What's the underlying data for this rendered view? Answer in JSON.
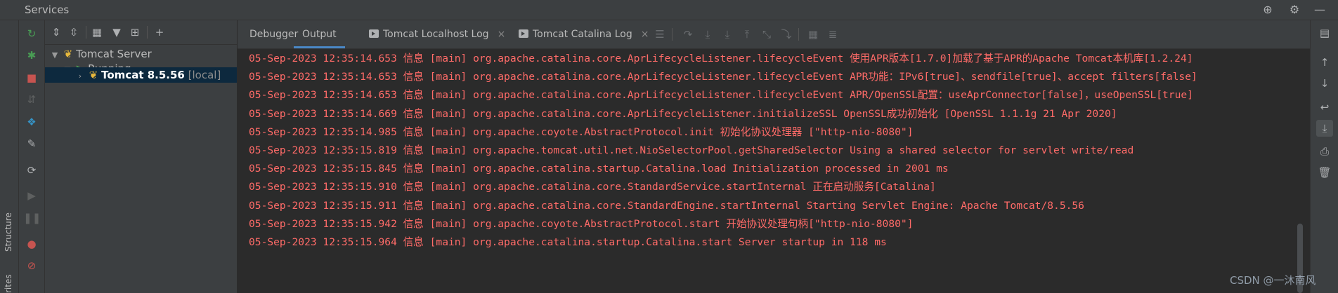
{
  "window": {
    "title": "Services",
    "icons": [
      "crosshair-icon",
      "gear-icon",
      "minimize-icon"
    ]
  },
  "left_strip": {
    "tabs": [
      {
        "label": "Structure"
      },
      {
        "label": "rites"
      }
    ]
  },
  "tree": {
    "nodes": [
      {
        "label": "Tomcat Server",
        "suffix": ""
      },
      {
        "label": "Running",
        "suffix": ""
      },
      {
        "label": "Tomcat 8.5.56",
        "suffix": "[local]"
      }
    ]
  },
  "console": {
    "tabs": [
      {
        "label": "Debugger"
      },
      {
        "label": "Output"
      },
      {
        "label": "Tomcat Localhost Log"
      },
      {
        "label": "Tomcat Catalina Log"
      }
    ],
    "close_glyph": "×",
    "lines": [
      "05-Sep-2023 12:35:14.653 信息 [main] org.apache.catalina.core.AprLifecycleListener.lifecycleEvent 使用APR版本[1.7.0]加载了基于APR的Apache Tomcat本机库[1.2.24]",
      "05-Sep-2023 12:35:14.653 信息 [main] org.apache.catalina.core.AprLifecycleListener.lifecycleEvent APR功能：IPv6[true]、sendfile[true]、accept filters[false]",
      "05-Sep-2023 12:35:14.653 信息 [main] org.apache.catalina.core.AprLifecycleListener.lifecycleEvent APR/OpenSSL配置：useAprConnector[false]，useOpenSSL[true]",
      "05-Sep-2023 12:35:14.669 信息 [main] org.apache.catalina.core.AprLifecycleListener.initializeSSL OpenSSL成功初始化 [OpenSSL 1.1.1g  21 Apr 2020]",
      "05-Sep-2023 12:35:14.985 信息 [main] org.apache.coyote.AbstractProtocol.init 初始化协议处理器 [\"http-nio-8080\"]",
      "05-Sep-2023 12:35:15.819 信息 [main] org.apache.tomcat.util.net.NioSelectorPool.getSharedSelector Using a shared selector for servlet write/read",
      "05-Sep-2023 12:35:15.845 信息 [main] org.apache.catalina.startup.Catalina.load Initialization processed in 2001 ms",
      "05-Sep-2023 12:35:15.910 信息 [main] org.apache.catalina.core.StandardService.startInternal 正在启动服务[Catalina]",
      "05-Sep-2023 12:35:15.911 信息 [main] org.apache.catalina.core.StandardEngine.startInternal Starting Servlet Engine: Apache Tomcat/8.5.56",
      "05-Sep-2023 12:35:15.942 信息 [main] org.apache.coyote.AbstractProtocol.start 开始协议处理句柄[\"http-nio-8080\"]",
      "05-Sep-2023 12:35:15.964 信息 [main] org.apache.catalina.startup.Catalina.start Server startup in 118 ms"
    ]
  },
  "watermark": "CSDN @一沐南风",
  "colors": {
    "log_text": "#ff6b68",
    "active_tab": "#4a88c7",
    "selection": "#0d293e",
    "run_green": "#499c54"
  }
}
